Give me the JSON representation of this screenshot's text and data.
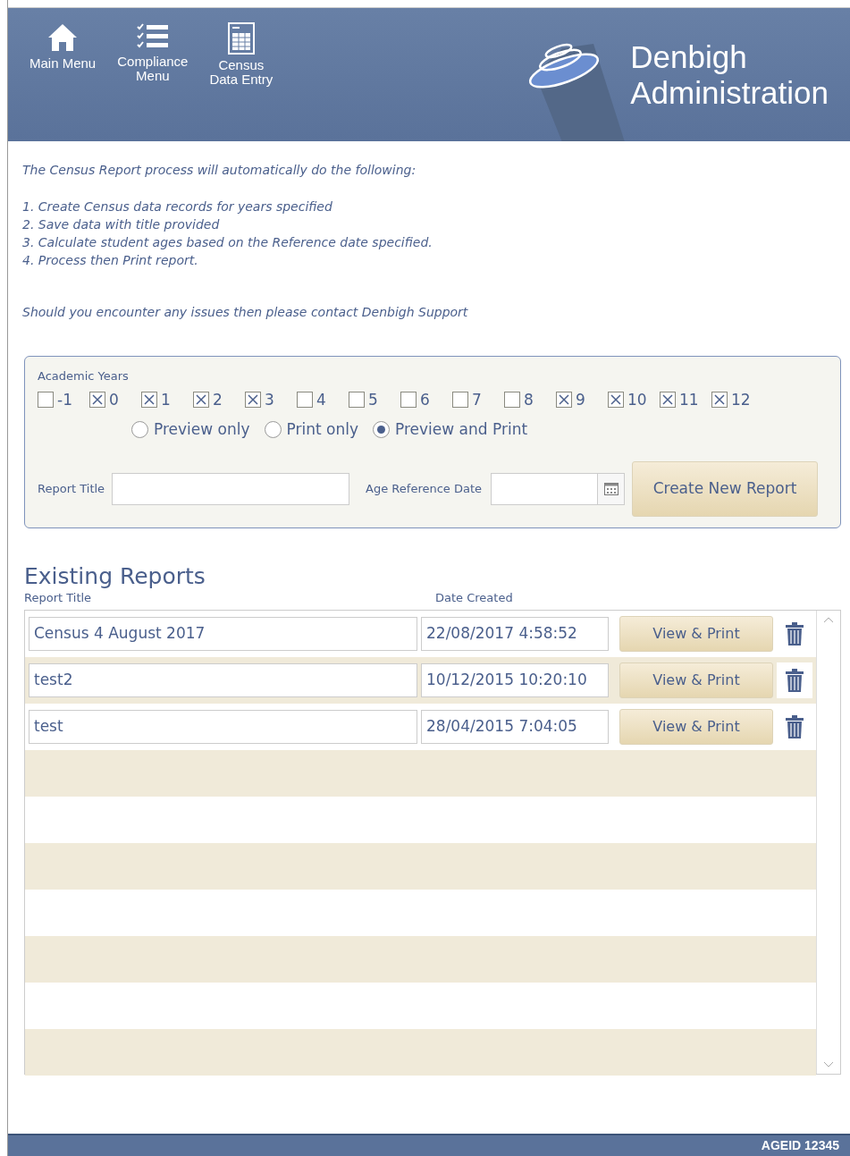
{
  "nav": [
    {
      "label": "Main Menu"
    },
    {
      "label": "Compliance\nMenu"
    },
    {
      "label": "Census\nData Entry"
    }
  ],
  "brand": {
    "line1": "Denbigh",
    "line2": "Administration"
  },
  "intro": "The Census Report process will automatically do the following:",
  "steps": [
    "1. Create Census data records for years specified",
    "2. Save data with title provided",
    "3. Calculate student ages based on the Reference date specified.",
    "4. Process then Print report."
  ],
  "support": "Should you encounter any issues then please contact Denbigh Support",
  "form": {
    "years_label": "Academic Years",
    "years": [
      {
        "label": "-1",
        "checked": false
      },
      {
        "label": "0",
        "checked": true
      },
      {
        "label": "1",
        "checked": true
      },
      {
        "label": "2",
        "checked": true
      },
      {
        "label": "3",
        "checked": true
      },
      {
        "label": "4",
        "checked": false
      },
      {
        "label": "5",
        "checked": false
      },
      {
        "label": "6",
        "checked": false
      },
      {
        "label": "7",
        "checked": false
      },
      {
        "label": "8",
        "checked": false
      },
      {
        "label": "9",
        "checked": true
      },
      {
        "label": "10",
        "checked": true
      },
      {
        "label": "11",
        "checked": true
      },
      {
        "label": "12",
        "checked": true
      }
    ],
    "modes": [
      {
        "label": "Preview only",
        "selected": false
      },
      {
        "label": "Print only",
        "selected": false
      },
      {
        "label": "Preview and Print",
        "selected": true
      }
    ],
    "title_label": "Report Title",
    "date_label": "Age Reference Date",
    "create_button": "Create New Report"
  },
  "reports": {
    "heading": "Existing Reports",
    "columns": [
      "Report Title",
      "Date Created"
    ],
    "rows": [
      {
        "title": "Census 4 August 2017",
        "date": "22/08/2017 4:58:52",
        "button": "View & Print",
        "selected": false
      },
      {
        "title": "test2",
        "date": "10/12/2015 10:20:10",
        "button": "View & Print",
        "selected": true
      },
      {
        "title": "test",
        "date": "28/04/2015 7:04:05",
        "button": "View & Print",
        "selected": false
      }
    ]
  },
  "footer": "AGEID 12345"
}
